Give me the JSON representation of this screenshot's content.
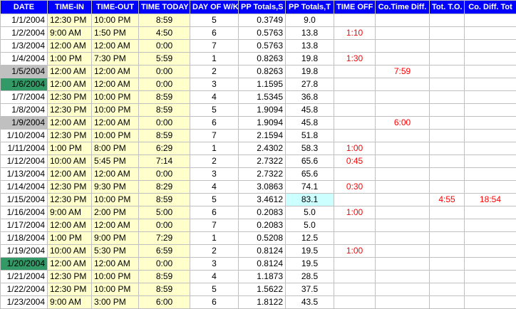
{
  "sheet": {
    "headers": [
      "DATE",
      "TIME-IN",
      "TIME-OUT",
      "TIME TODAY",
      "DAY OF W/K",
      "PP Totals,S",
      "PP Totals,T",
      "TIME OFF",
      "Co.Time Diff.",
      "Tot. T.O.",
      "Co. Diff. Tot"
    ],
    "rows": [
      {
        "date": "1/1/2004",
        "in": "12:30 PM",
        "out": "10:00 PM",
        "today": "8:59",
        "day": "5",
        "pps": "0.3749",
        "ppt": "9.0",
        "off": "",
        "ctd": "",
        "tto": "",
        "cdt": ""
      },
      {
        "date": "1/2/2004",
        "in": "9:00 AM",
        "out": "1:50 PM",
        "today": "4:50",
        "day": "6",
        "pps": "0.5763",
        "ppt": "13.8",
        "off": "1:10",
        "ctd": "",
        "tto": "",
        "cdt": ""
      },
      {
        "date": "1/3/2004",
        "in": "12:00 AM",
        "out": "12:00 AM",
        "today": "0:00",
        "day": "7",
        "pps": "0.5763",
        "ppt": "13.8",
        "off": "",
        "ctd": "",
        "tto": "",
        "cdt": ""
      },
      {
        "date": "1/4/2004",
        "in": "1:00 PM",
        "out": "7:30 PM",
        "today": "5:59",
        "day": "1",
        "pps": "0.8263",
        "ppt": "19.8",
        "off": "1:30",
        "ctd": "",
        "tto": "",
        "cdt": ""
      },
      {
        "date": "1/5/2004",
        "in": "12:00 AM",
        "out": "12:00 AM",
        "today": "0:00",
        "day": "2",
        "pps": "0.8263",
        "ppt": "19.8",
        "off": "",
        "ctd": "7:59",
        "tto": "",
        "cdt": "",
        "style": "grey"
      },
      {
        "date": "1/6/2004",
        "in": "12:00 AM",
        "out": "12:00 AM",
        "today": "0:00",
        "day": "3",
        "pps": "1.1595",
        "ppt": "27.8",
        "off": "",
        "ctd": "",
        "tto": "",
        "cdt": "",
        "style": "green"
      },
      {
        "date": "1/7/2004",
        "in": "12:30 PM",
        "out": "10:00 PM",
        "today": "8:59",
        "day": "4",
        "pps": "1.5345",
        "ppt": "36.8",
        "off": "",
        "ctd": "",
        "tto": "",
        "cdt": ""
      },
      {
        "date": "1/8/2004",
        "in": "12:30 PM",
        "out": "10:00 PM",
        "today": "8:59",
        "day": "5",
        "pps": "1.9094",
        "ppt": "45.8",
        "off": "",
        "ctd": "",
        "tto": "",
        "cdt": ""
      },
      {
        "date": "1/9/2004",
        "in": "12:00 AM",
        "out": "12:00 AM",
        "today": "0:00",
        "day": "6",
        "pps": "1.9094",
        "ppt": "45.8",
        "off": "",
        "ctd": "6:00",
        "tto": "",
        "cdt": "",
        "style": "grey"
      },
      {
        "date": "1/10/2004",
        "in": "12:30 PM",
        "out": "10:00 PM",
        "today": "8:59",
        "day": "7",
        "pps": "2.1594",
        "ppt": "51.8",
        "off": "",
        "ctd": "",
        "tto": "",
        "cdt": ""
      },
      {
        "date": "1/11/2004",
        "in": "1:00 PM",
        "out": "8:00 PM",
        "today": "6:29",
        "day": "1",
        "pps": "2.4302",
        "ppt": "58.3",
        "off": "1:00",
        "ctd": "",
        "tto": "",
        "cdt": ""
      },
      {
        "date": "1/12/2004",
        "in": "10:00 AM",
        "out": "5:45 PM",
        "today": "7:14",
        "day": "2",
        "pps": "2.7322",
        "ppt": "65.6",
        "off": "0:45",
        "ctd": "",
        "tto": "",
        "cdt": ""
      },
      {
        "date": "1/13/2004",
        "in": "12:00 AM",
        "out": "12:00 AM",
        "today": "0:00",
        "day": "3",
        "pps": "2.7322",
        "ppt": "65.6",
        "off": "",
        "ctd": "",
        "tto": "",
        "cdt": ""
      },
      {
        "date": "1/14/2004",
        "in": "12:30 PM",
        "out": "9:30 PM",
        "today": "8:29",
        "day": "4",
        "pps": "3.0863",
        "ppt": "74.1",
        "off": "0:30",
        "ctd": "",
        "tto": "",
        "cdt": ""
      },
      {
        "date": "1/15/2004",
        "in": "12:30 PM",
        "out": "10:00 PM",
        "today": "8:59",
        "day": "5",
        "pps": "3.4612",
        "ppt": "83.1",
        "off": "",
        "ctd": "",
        "tto": "4:55",
        "cdt": "18:54",
        "ppt_style": "hl"
      },
      {
        "date": "1/16/2004",
        "in": "9:00 AM",
        "out": "2:00 PM",
        "today": "5:00",
        "day": "6",
        "pps": "0.2083",
        "ppt": "5.0",
        "off": "1:00",
        "ctd": "",
        "tto": "",
        "cdt": ""
      },
      {
        "date": "1/17/2004",
        "in": "12:00 AM",
        "out": "12:00 AM",
        "today": "0:00",
        "day": "7",
        "pps": "0.2083",
        "ppt": "5.0",
        "off": "",
        "ctd": "",
        "tto": "",
        "cdt": ""
      },
      {
        "date": "1/18/2004",
        "in": "1:00 PM",
        "out": "9:00 PM",
        "today": "7:29",
        "day": "1",
        "pps": "0.5208",
        "ppt": "12.5",
        "off": "",
        "ctd": "",
        "tto": "",
        "cdt": ""
      },
      {
        "date": "1/19/2004",
        "in": "10:00 AM",
        "out": "5:30 PM",
        "today": "6:59",
        "day": "2",
        "pps": "0.8124",
        "ppt": "19.5",
        "off": "1:00",
        "ctd": "",
        "tto": "",
        "cdt": ""
      },
      {
        "date": "1/20/2004",
        "in": "12:00 AM",
        "out": "12:00 AM",
        "today": "0:00",
        "day": "3",
        "pps": "0.8124",
        "ppt": "19.5",
        "off": "",
        "ctd": "",
        "tto": "",
        "cdt": "",
        "style": "green"
      },
      {
        "date": "1/21/2004",
        "in": "12:30 PM",
        "out": "10:00 PM",
        "today": "8:59",
        "day": "4",
        "pps": "1.1873",
        "ppt": "28.5",
        "off": "",
        "ctd": "",
        "tto": "",
        "cdt": ""
      },
      {
        "date": "1/22/2004",
        "in": "12:30 PM",
        "out": "10:00 PM",
        "today": "8:59",
        "day": "5",
        "pps": "1.5622",
        "ppt": "37.5",
        "off": "",
        "ctd": "",
        "tto": "",
        "cdt": ""
      },
      {
        "date": "1/23/2004",
        "in": "9:00 AM",
        "out": "3:00 PM",
        "today": "6:00",
        "day": "6",
        "pps": "1.8122",
        "ppt": "43.5",
        "off": "",
        "ctd": "",
        "tto": "",
        "cdt": ""
      }
    ]
  },
  "colors": {
    "header_bg": "#0000ff",
    "header_text": "#ffffff",
    "time_bg": "#ffffcc",
    "grey_date": "#c0c0c0",
    "green_date": "#339966",
    "highlight": "#ccffff",
    "red_text": "#ff0000"
  }
}
